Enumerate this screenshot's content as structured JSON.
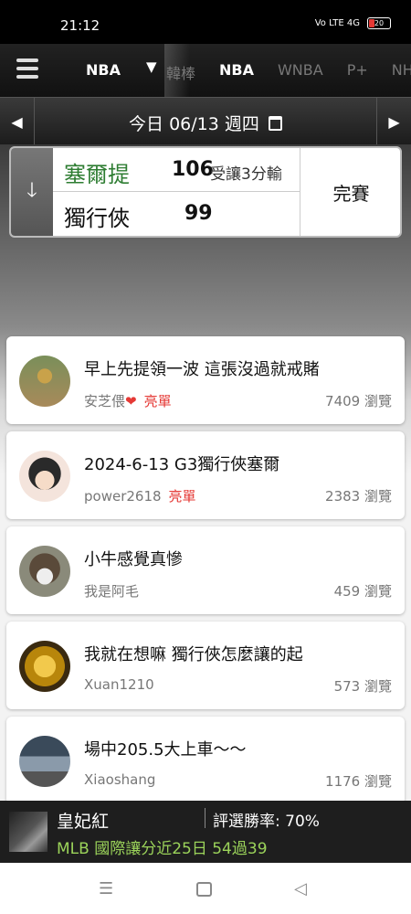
{
  "status": {
    "time": "21:12",
    "signal_text": "Vo LTE 4G",
    "battery": "20"
  },
  "nav": {
    "league": "NBA",
    "tabs": [
      "韓棒",
      "NBA",
      "WNBA",
      "P+",
      "NHL"
    ],
    "active_tab": "NBA"
  },
  "date": {
    "label": "今日 06/13 週四"
  },
  "game": {
    "home_team": "塞爾提",
    "home_score": "106",
    "spread": "受讓3分輸",
    "away_team": "獨行俠",
    "away_score": "99",
    "status": "完賽"
  },
  "posts": [
    {
      "title": "早上先提領一波 這張沒過就戒賭",
      "author": "安芝偎",
      "heart": "❤",
      "badge": "亮單",
      "views": "7409 瀏覽",
      "avatar": "baseball-player-avatar"
    },
    {
      "title": "2024-6-13 G3獨行俠塞爾",
      "author": "power2618",
      "heart": "",
      "badge": "亮單",
      "views": "2383 瀏覽",
      "avatar": "anime-girl-avatar"
    },
    {
      "title": "小牛感覺真慘",
      "author": "我是阿毛",
      "heart": "",
      "badge": "",
      "views": "459 瀏覽",
      "avatar": "woman-mask-avatar"
    },
    {
      "title": "我就在想嘛 獨行俠怎麼讓的起",
      "author": "Xuan1210",
      "heart": "",
      "badge": "",
      "views": "573 瀏覽",
      "avatar": "gold-emblem-avatar"
    },
    {
      "title": "場中205.5大上車～～",
      "author": "Xiaoshang",
      "heart": "",
      "badge": "",
      "views": "1176 瀏覽",
      "avatar": "street-photo-avatar"
    }
  ],
  "banner": {
    "name": "皇妃紅",
    "rate": "評選勝率: 70%",
    "record": "MLB 國際讓分近25日 54過39"
  },
  "colors": {
    "winner_green": "#2e7d32",
    "badge_red": "#e53935",
    "record_green": "#9bd35a"
  }
}
